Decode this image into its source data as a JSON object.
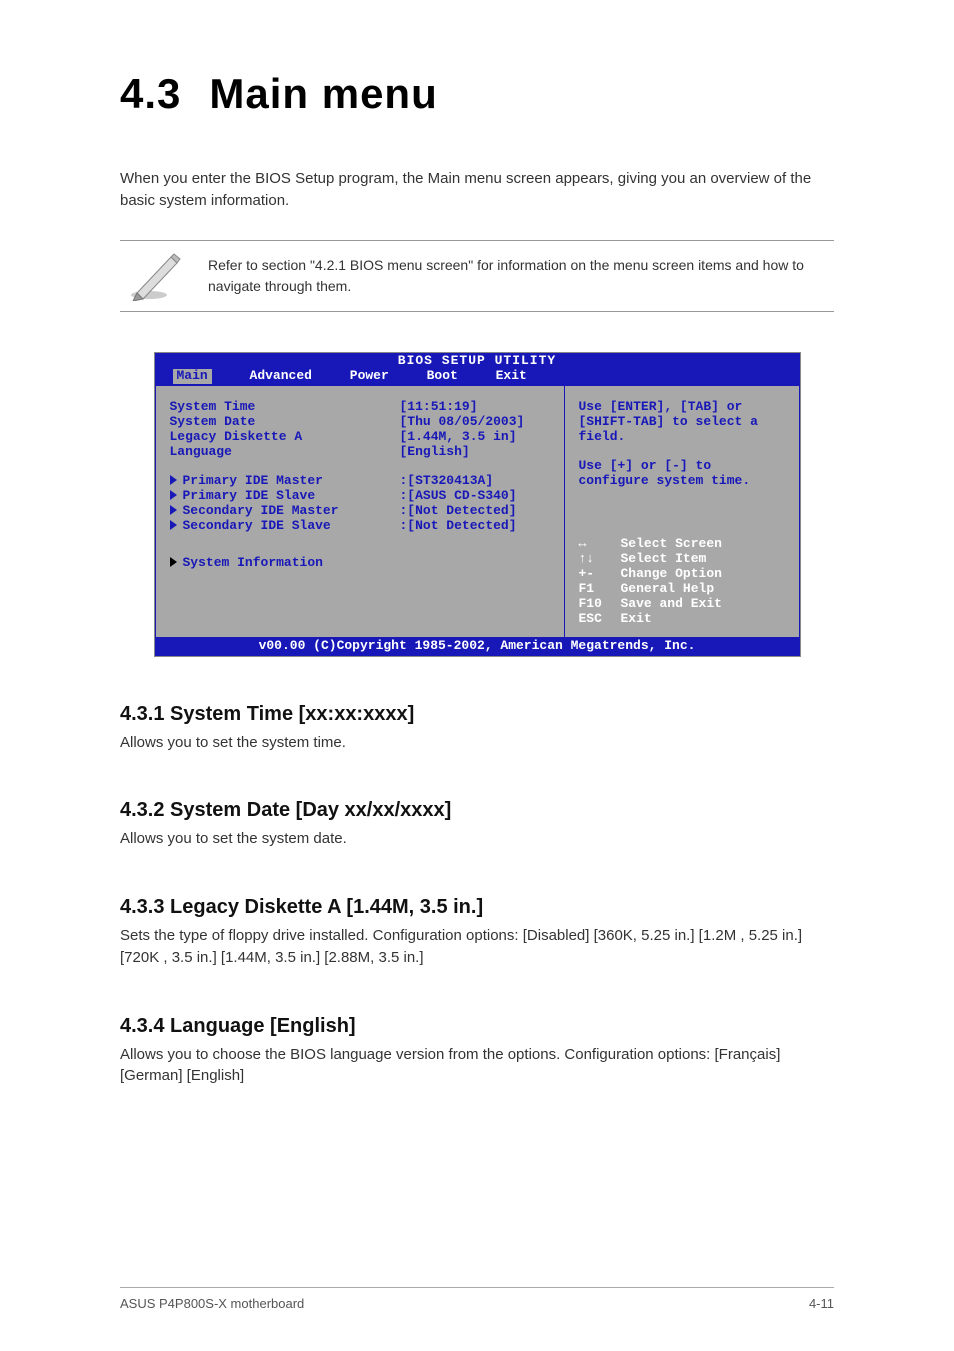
{
  "heading_num": "4.3",
  "heading_text": "Main menu",
  "intro": "When you enter the BIOS Setup program, the Main menu screen appears, giving you an overview of the basic system information.",
  "note": "Refer to section \"4.2.1 BIOS menu screen\" for information on the menu screen items and how to navigate through them.",
  "bios": {
    "title": "BIOS SETUP UTILITY",
    "menu": [
      "Main",
      "Advanced",
      "Power",
      "Boot",
      "Exit"
    ],
    "selected_menu": "Main",
    "fields": {
      "system_time_label": "System Time",
      "system_time_value": "[11:51:19]",
      "system_date_label": "System Date",
      "system_date_value": "[Thu 08/05/2003]",
      "legacy_label": "Legacy Diskette A",
      "legacy_value": "[1.44M, 3.5 in]",
      "language_label": "Language",
      "language_value": "[English]"
    },
    "submenus": [
      {
        "label": "Primary IDE Master",
        "value": ":[ST320413A]"
      },
      {
        "label": "Primary IDE Slave",
        "value": ":[ASUS CD-S340]"
      },
      {
        "label": "Secondary IDE Master",
        "value": ":[Not Detected]"
      },
      {
        "label": "Secondary IDE Slave",
        "value": ":[Not Detected]"
      }
    ],
    "sysinfo_label": "System Information",
    "help1": "Use [ENTER], [TAB] or [SHIFT-TAB] to select a field.",
    "help2": "Use [+] or [-] to configure system time.",
    "keys": [
      {
        "k": "↔",
        "d": "Select Screen"
      },
      {
        "k": "↑↓",
        "d": "Select Item"
      },
      {
        "k": "+-",
        "d": "Change Option"
      },
      {
        "k": "F1",
        "d": "General Help"
      },
      {
        "k": "F10",
        "d": "Save and Exit"
      },
      {
        "k": "ESC",
        "d": "Exit"
      }
    ],
    "footer": "v00.00 (C)Copyright 1985-2002, American Megatrends, Inc."
  },
  "sec431_title": "4.3.1 System Time [xx:xx:xxxx]",
  "sec431_body": "Allows you to set the system time.",
  "sec432_title": "4.3.2 System Date [Day xx/xx/xxxx]",
  "sec432_body": "Allows you to set the system date.",
  "sec433_title": "4.3.3 Legacy Diskette A [1.44M, 3.5 in.]",
  "sec433_body": "Sets the type of floppy drive installed. Configuration options: [Disabled] [360K, 5.25 in.] [1.2M , 5.25 in.] [720K , 3.5 in.] [1.44M, 3.5 in.] [2.88M, 3.5 in.]",
  "sec434_title": "4.3.4 Language [English]",
  "sec434_body": "Allows you to choose the BIOS language version from the options. Configuration options: [Français] [German] [English]",
  "page_footer_left": "ASUS P4P800S-X motherboard",
  "page_footer_right": "4-11"
}
